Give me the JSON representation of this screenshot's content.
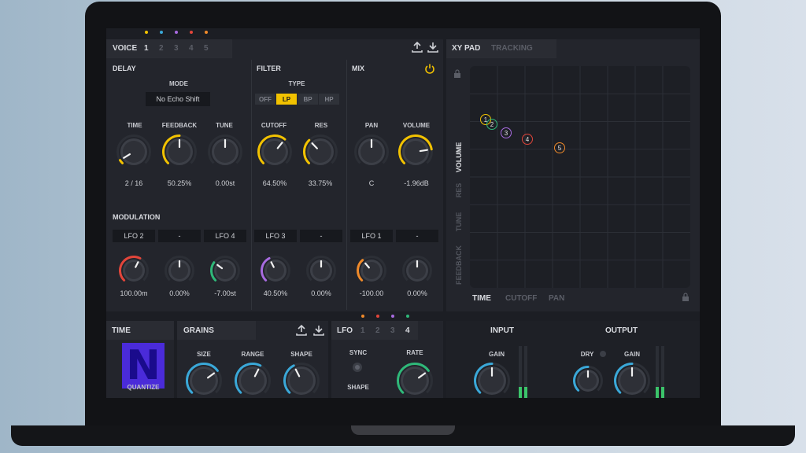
{
  "colors": {
    "accent_yellow": "#f2c200",
    "red": "#e2453a",
    "green": "#2fb879",
    "purple": "#a86be0",
    "orange": "#f08a2a",
    "blue": "#3aa8d8"
  },
  "voice": {
    "label": "VOICE",
    "tabs": [
      "1",
      "2",
      "3",
      "4",
      "5"
    ],
    "dot_colors": [
      "#f2c200",
      "#3aa8d8",
      "#a86be0",
      "#e2453a",
      "#f08a2a"
    ]
  },
  "delay": {
    "title": "DELAY",
    "mode_label": "MODE",
    "mode_value": "No Echo Shift",
    "knobs": [
      {
        "label": "TIME",
        "value": "2 / 16",
        "level": 0.05
      },
      {
        "label": "FEEDBACK",
        "value": "50.25%",
        "level": 0.5
      },
      {
        "label": "TUNE",
        "value": "0.00st",
        "level": 0.5
      }
    ]
  },
  "filter": {
    "title": "FILTER",
    "type_label": "TYPE",
    "types": [
      "OFF",
      "LP",
      "BP",
      "HP"
    ],
    "active_type": "LP",
    "knobs": [
      {
        "label": "CUTOFF",
        "value": "64.50%",
        "level": 0.645
      },
      {
        "label": "RES",
        "value": "33.75%",
        "level": 0.3375
      }
    ]
  },
  "mix": {
    "title": "MIX",
    "knobs": [
      {
        "label": "PAN",
        "value": "C",
        "level": 0.5
      },
      {
        "label": "VOLUME",
        "value": "-1.96dB",
        "level": 0.8
      }
    ]
  },
  "modulation": {
    "title": "MODULATION",
    "slots": [
      {
        "source": "LFO 2",
        "value": "100.00m",
        "color": "#e2453a",
        "level": 0.6
      },
      {
        "source": "-",
        "value": "0.00%",
        "color": "",
        "level": 0.5
      },
      {
        "source": "LFO 4",
        "value": "-7.00st",
        "color": "#2fb879",
        "level": 0.3
      },
      {
        "source": "LFO 3",
        "value": "40.50%",
        "color": "#a86be0",
        "level": 0.4
      },
      {
        "source": "-",
        "value": "0.00%",
        "color": "",
        "level": 0.5
      },
      {
        "source": "LFO 1",
        "value": "-100.00",
        "color": "#f08a2a",
        "level": 0.35
      },
      {
        "source": "-",
        "value": "0.00%",
        "color": "",
        "level": 0.5
      }
    ]
  },
  "xypad": {
    "tabs": [
      "XY PAD",
      "TRACKING"
    ],
    "y_axis": [
      "VOLUME",
      "RES",
      "TUNE",
      "FEEDBACK"
    ],
    "x_axis": [
      "TIME",
      "CUTOFF",
      "PAN"
    ],
    "points": [
      {
        "label": "1",
        "color": "#f2c200"
      },
      {
        "label": "2",
        "color": "#2fb879"
      },
      {
        "label": "3",
        "color": "#a86be0"
      },
      {
        "label": "4",
        "color": "#e2453a"
      },
      {
        "label": "5",
        "color": "#f08a2a"
      }
    ]
  },
  "time": {
    "title": "TIME",
    "logo_letter": "N",
    "sub_label": "QUANTIZE"
  },
  "grains": {
    "title": "GRAINS",
    "knobs": [
      {
        "label": "SIZE",
        "level": 0.7
      },
      {
        "label": "RANGE",
        "level": 0.6
      },
      {
        "label": "SHAPE",
        "level": 0.4
      }
    ]
  },
  "lfo": {
    "title": "LFO",
    "tabs": [
      "1",
      "2",
      "3",
      "4"
    ],
    "active_tab": "4",
    "sync_label": "SYNC",
    "shape_label": "SHAPE",
    "rate_label": "RATE",
    "dot_colors": [
      "#f08a2a",
      "#e2453a",
      "#a86be0",
      "#2fb879"
    ]
  },
  "input": {
    "title": "INPUT",
    "gain_label": "GAIN"
  },
  "output": {
    "title": "OUTPUT",
    "dry_label": "DRY",
    "gain_label": "GAIN"
  }
}
